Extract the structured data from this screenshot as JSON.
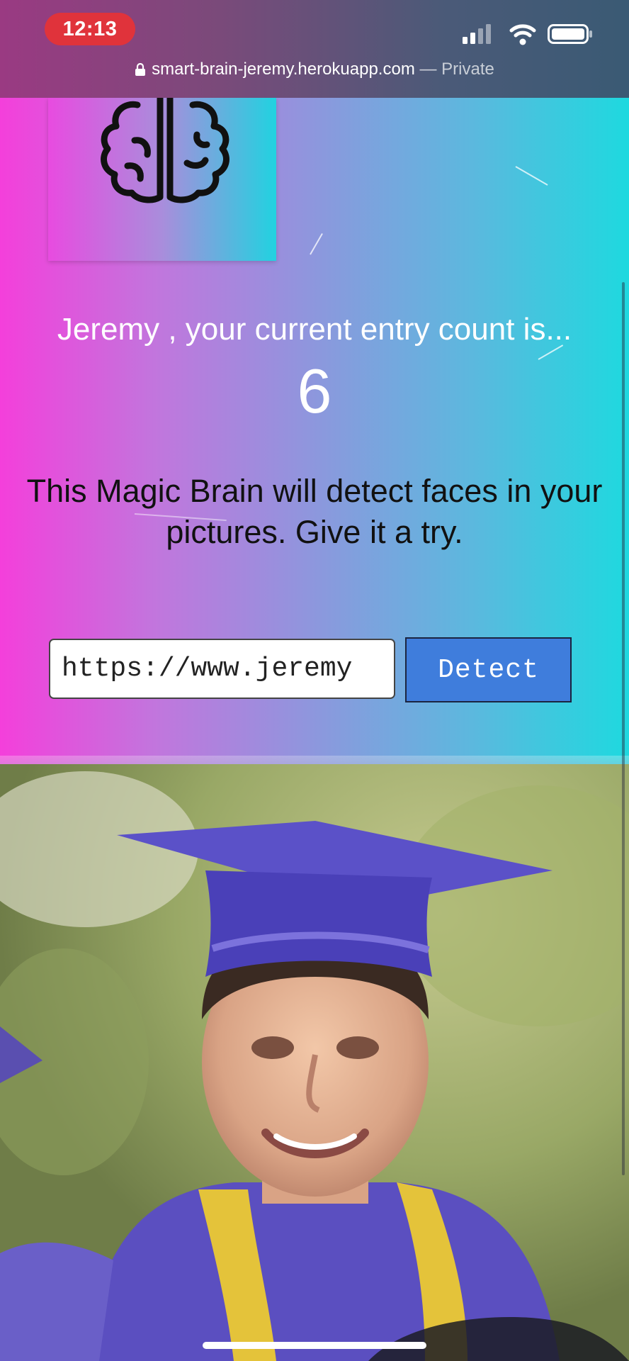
{
  "status_bar": {
    "time": "12:13",
    "icons": [
      "signal-icon",
      "wifi-icon",
      "battery-icon"
    ]
  },
  "browser": {
    "url": "smart-brain-jeremy.herokuapp.com",
    "mode_label": "— Private"
  },
  "app": {
    "logo": "brain-icon",
    "entry_text": "Jeremy , your current entry count is...",
    "entry_count": "6",
    "tagline": "This Magic Brain will detect faces in your pictures. Give it a try.",
    "image_url_value": "https://www.jeremy",
    "detect_label": "Detect"
  },
  "colors": {
    "gradient_left": "#f43fdb",
    "gradient_right": "#1ed9df",
    "button": "#3f7ddc",
    "time_pill": "#e0333b"
  }
}
